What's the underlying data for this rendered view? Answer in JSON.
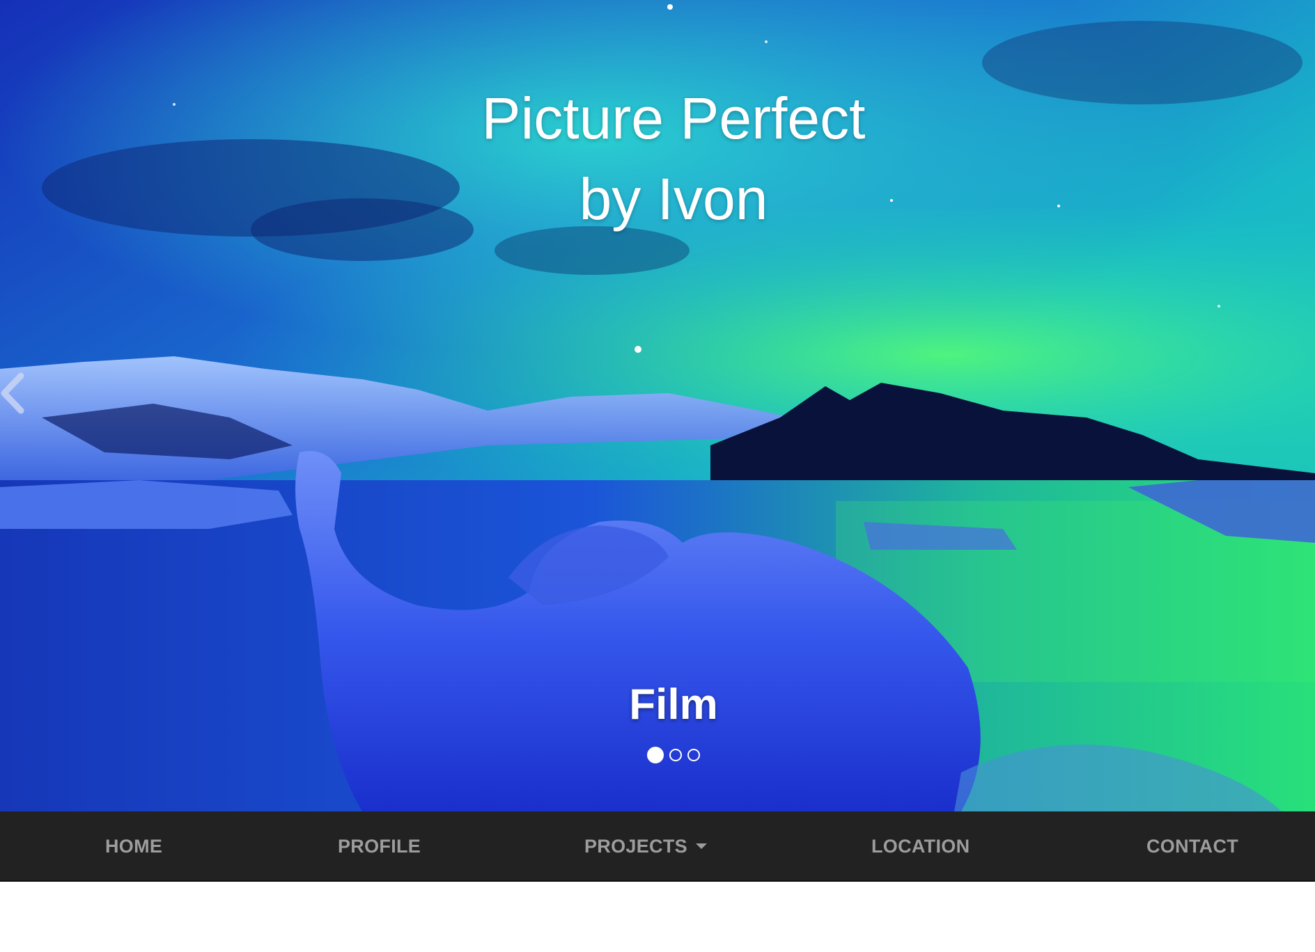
{
  "hero": {
    "title_line1": "Picture Perfect",
    "title_line2": "by Ivon",
    "caption": "Film",
    "slide_count": 3,
    "active_slide": 1,
    "colors": {
      "sky_top": "#1a3fc4",
      "aurora_teal": "#19c8c0",
      "aurora_green": "#3ff06a",
      "water": "#1e4fd8",
      "ice": "#3a5ef0"
    }
  },
  "nav": {
    "items": [
      {
        "label": "HOME"
      },
      {
        "label": "PROFILE"
      },
      {
        "label": "PROJECTS",
        "has_dropdown": true
      },
      {
        "label": "LOCATION"
      },
      {
        "label": "CONTACT"
      }
    ],
    "background": "#222222",
    "text_color": "#9d9d9d"
  },
  "icons": {
    "prev": "chevron-left-icon",
    "dropdown": "caret-down-icon"
  }
}
